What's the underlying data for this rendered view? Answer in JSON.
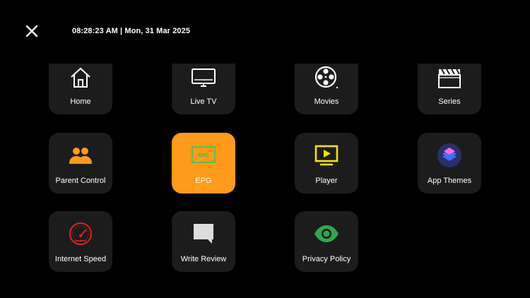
{
  "header": {
    "datetime": "08:28:23 AM | Mon, 31 Mar 2025"
  },
  "menu": {
    "items": [
      {
        "label": "Home",
        "icon": "home-icon"
      },
      {
        "label": "Live TV",
        "icon": "tv-icon"
      },
      {
        "label": "Movies",
        "icon": "film-reel-icon"
      },
      {
        "label": "Series",
        "icon": "clapperboard-icon"
      },
      {
        "label": "Parent Control",
        "icon": "people-icon"
      },
      {
        "label": "EPG",
        "icon": "epg-icon"
      },
      {
        "label": "Player",
        "icon": "play-screen-icon"
      },
      {
        "label": "App Themes",
        "icon": "layers-icon"
      },
      {
        "label": "Internet Speed",
        "icon": "speedometer-icon"
      },
      {
        "label": "Write Review",
        "icon": "chat-bubble-icon"
      },
      {
        "label": "Privacy Policy",
        "icon": "eye-icon"
      }
    ],
    "selected": "EPG",
    "epg_icon_text": "EPG"
  },
  "colors": {
    "background": "#000000",
    "tile": "#1c1c1c",
    "accent": "#ff9a1a",
    "parent_icon": "#ff9a1a",
    "player_icon": "#f5e400",
    "speed_icon": "#e02020",
    "privacy_icon": "#2fa84f",
    "epg_icon": "#34c759"
  }
}
